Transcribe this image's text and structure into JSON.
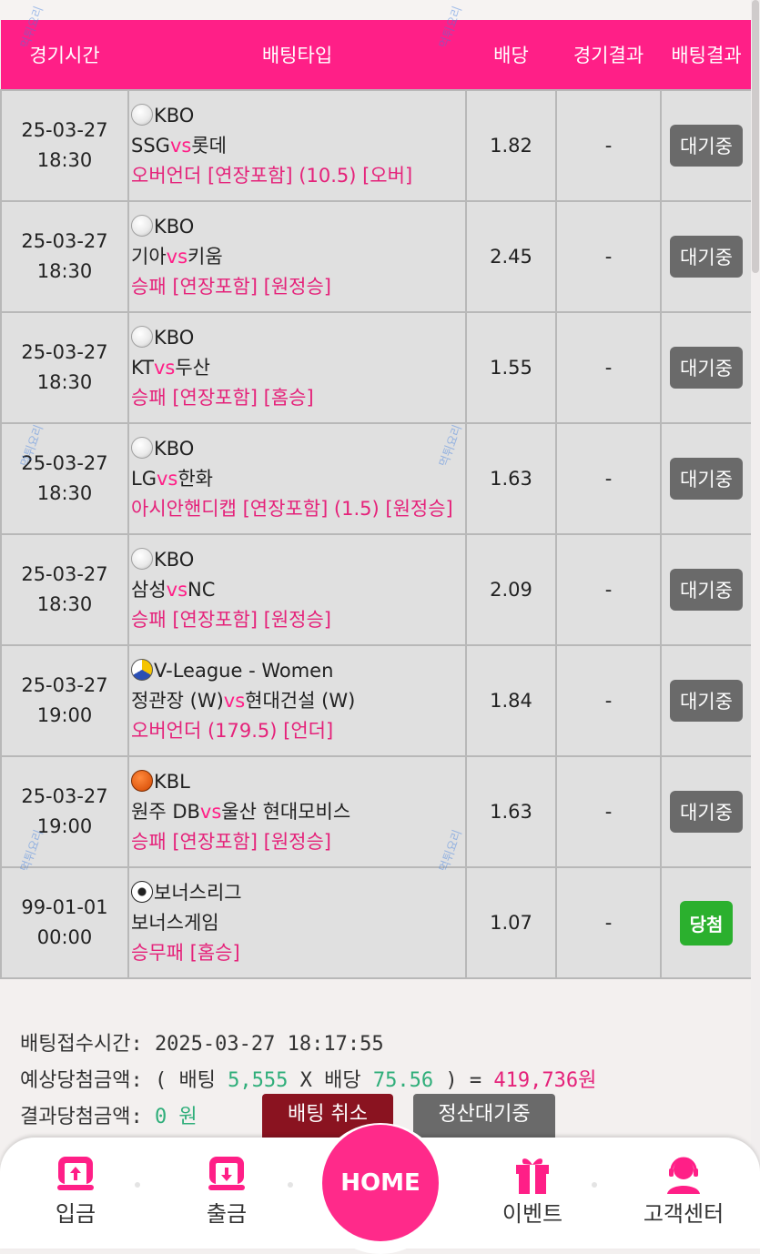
{
  "header": {
    "time_label": "경기시간",
    "type_label": "배팅타입",
    "odds_label": "배당",
    "game_result_label": "경기결과",
    "bet_result_label": "배팅결과"
  },
  "bets": [
    {
      "date": "25-03-27",
      "time": "18:30",
      "league_icon": "baseball-icon",
      "league": "KBO",
      "home": "SSG",
      "vs": "vs",
      "away": "롯데",
      "pick": "오버언더 [연장포함] (10.5) [오버]",
      "odds": "1.82",
      "result": "-",
      "status": "대기중"
    },
    {
      "date": "25-03-27",
      "time": "18:30",
      "league_icon": "baseball-icon",
      "league": "KBO",
      "home": "기아",
      "vs": "vs",
      "away": "키움",
      "pick": "승패 [연장포함] [원정승]",
      "odds": "2.45",
      "result": "-",
      "status": "대기중"
    },
    {
      "date": "25-03-27",
      "time": "18:30",
      "league_icon": "baseball-icon",
      "league": "KBO",
      "home": "KT",
      "vs": "vs",
      "away": "두산",
      "pick": "승패 [연장포함] [홈승]",
      "odds": "1.55",
      "result": "-",
      "status": "대기중"
    },
    {
      "date": "25-03-27",
      "time": "18:30",
      "league_icon": "baseball-icon",
      "league": "KBO",
      "home": "LG",
      "vs": "vs",
      "away": "한화",
      "pick": "아시안핸디캡 [연장포함] (1.5) [원정승]",
      "odds": "1.63",
      "result": "-",
      "status": "대기중"
    },
    {
      "date": "25-03-27",
      "time": "18:30",
      "league_icon": "baseball-icon",
      "league": "KBO",
      "home": "삼성",
      "vs": "vs",
      "away": "NC",
      "pick": "승패 [연장포함] [원정승]",
      "odds": "2.09",
      "result": "-",
      "status": "대기중"
    },
    {
      "date": "25-03-27",
      "time": "19:00",
      "league_icon": "volleyball-icon",
      "league": "V-League - Women",
      "home": "정관장 (W)",
      "vs": "vs",
      "away": "현대건설 (W)",
      "pick": "오버언더 (179.5) [언더]",
      "odds": "1.84",
      "result": "-",
      "status": "대기중"
    },
    {
      "date": "25-03-27",
      "time": "19:00",
      "league_icon": "basketball-icon",
      "league": "KBL",
      "home": "원주 DB",
      "vs": "vs",
      "away": "울산 현대모비스",
      "pick": "승패 [연장포함] [원정승]",
      "odds": "1.63",
      "result": "-",
      "status": "대기중"
    },
    {
      "date": "99-01-01",
      "time": "00:00",
      "league_icon": "soccer-ball-icon",
      "league": "보너스리그",
      "home": "보너스게임",
      "vs": "",
      "away": "",
      "pick": "승무패 [홈승]",
      "odds": "1.07",
      "result": "-",
      "status": "당첨"
    }
  ],
  "summary": {
    "accept_time_label": "배팅접수시간:",
    "accept_time": "2025-03-27 18:17:55",
    "expected_label": "예상당첨금액:",
    "open_paren": "(",
    "bet_label": "배팅",
    "bet_amount": "5,555",
    "times": "X",
    "odds_label": "배당",
    "total_odds": "75.56",
    "close_paren": ")",
    "equals": "=",
    "expected_amount": "419,736원",
    "result_label": "결과당첨금액:",
    "result_amount": "0 원"
  },
  "buttons": {
    "cancel": "배팅 취소",
    "settle": "정산대기중"
  },
  "nav": {
    "deposit": "입금",
    "withdraw": "출금",
    "home": "HOME",
    "event": "이벤트",
    "support": "고객센터"
  },
  "watermark": "먹튀요리",
  "colors": {
    "header_bg": "#ff1f87",
    "vs": "#ff1f87",
    "pick": "#e5227a",
    "wait_button": "#6a6a6a",
    "win_button": "#2bb02e",
    "cancel_button": "#8a1320",
    "home_button": "#ff2a8a",
    "highlight_green": "#2fae7a"
  }
}
